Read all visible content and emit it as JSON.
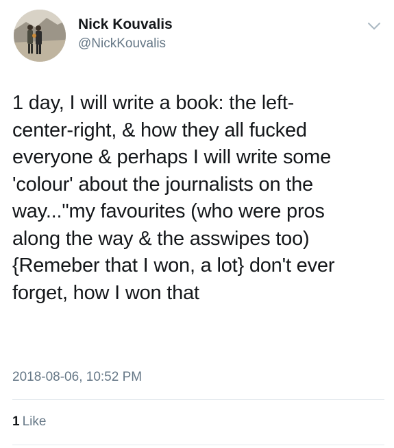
{
  "author": {
    "display_name": "Nick Kouvalis",
    "handle": "@NickKouvalis",
    "avatar_icon": "profile-photo"
  },
  "tweet": {
    "text": "1 day, I will write a book: the left-\ncenter-right, & how they all fucked\neveryone & perhaps I will write some\n'colour' about the journalists on the\nway...\"my favourites (who were pros\nalong the way & the asswipes too)\n{Remeber that I won, a lot} don't ever\nforget, how I won that",
    "timestamp": "2018-08-06, 10:52 PM"
  },
  "stats": {
    "likes_count": "1",
    "likes_label": "Like"
  },
  "icons": {
    "menu": "chevron-down-icon"
  },
  "colors": {
    "text": "#14171a",
    "secondary": "#657786",
    "divider": "#e1e8ed",
    "caret": "#aab8c2"
  }
}
